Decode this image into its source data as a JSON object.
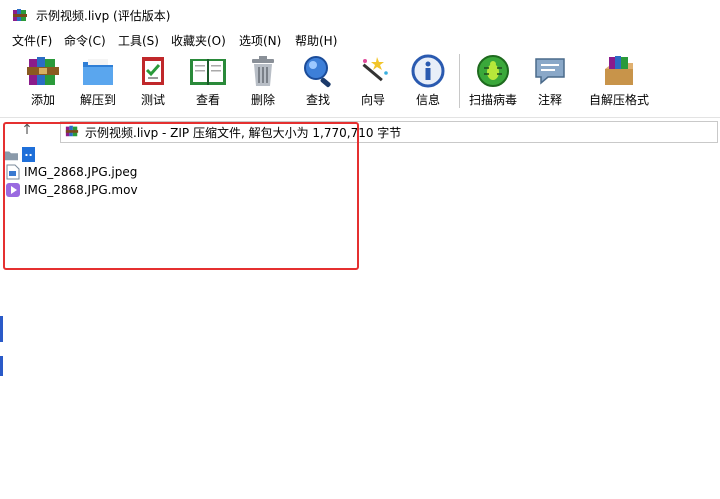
{
  "window": {
    "title": "示例视频.livp (评估版本)",
    "app_icon": "winrar-books-icon"
  },
  "menu": [
    {
      "label": "文件(F)",
      "name": "file"
    },
    {
      "label": "命令(C)",
      "name": "commands"
    },
    {
      "label": "工具(S)",
      "name": "tools"
    },
    {
      "label": "收藏夹(O)",
      "name": "favorites"
    },
    {
      "label": "选项(N)",
      "name": "options"
    },
    {
      "label": "帮助(H)",
      "name": "help"
    }
  ],
  "toolbar": [
    {
      "label": "添加",
      "name": "add",
      "icon": "archive-books-icon"
    },
    {
      "label": "解压到",
      "name": "extract-to",
      "icon": "folder-icon"
    },
    {
      "label": "测试",
      "name": "test",
      "icon": "checklist-icon"
    },
    {
      "label": "查看",
      "name": "view",
      "icon": "open-book-icon"
    },
    {
      "label": "删除",
      "name": "delete",
      "icon": "trash-icon"
    },
    {
      "label": "查找",
      "name": "find",
      "icon": "magnifier-icon"
    },
    {
      "label": "向导",
      "name": "wizard",
      "icon": "magic-wand-icon"
    },
    {
      "label": "信息",
      "name": "info",
      "icon": "info-icon"
    },
    {
      "label": "扫描病毒",
      "name": "scan-virus",
      "icon": "bug-icon"
    },
    {
      "label": "注释",
      "name": "comment",
      "icon": "comment-icon"
    },
    {
      "label": "自解压格式",
      "name": "sfx",
      "icon": "box-icon"
    }
  ],
  "address": {
    "text": "示例视频.livp - ZIP 压缩文件, 解包大小为 1,770,710 字节",
    "up_label": "↑"
  },
  "files": {
    "parent": "..",
    "items": [
      {
        "name": "IMG_2868.JPG.jpeg",
        "icon": "image-file-icon"
      },
      {
        "name": "IMG_2868.JPG.mov",
        "icon": "video-file-icon"
      }
    ]
  },
  "colors": {
    "highlight_border": "#e53030",
    "selection": "#1e6fd9"
  }
}
